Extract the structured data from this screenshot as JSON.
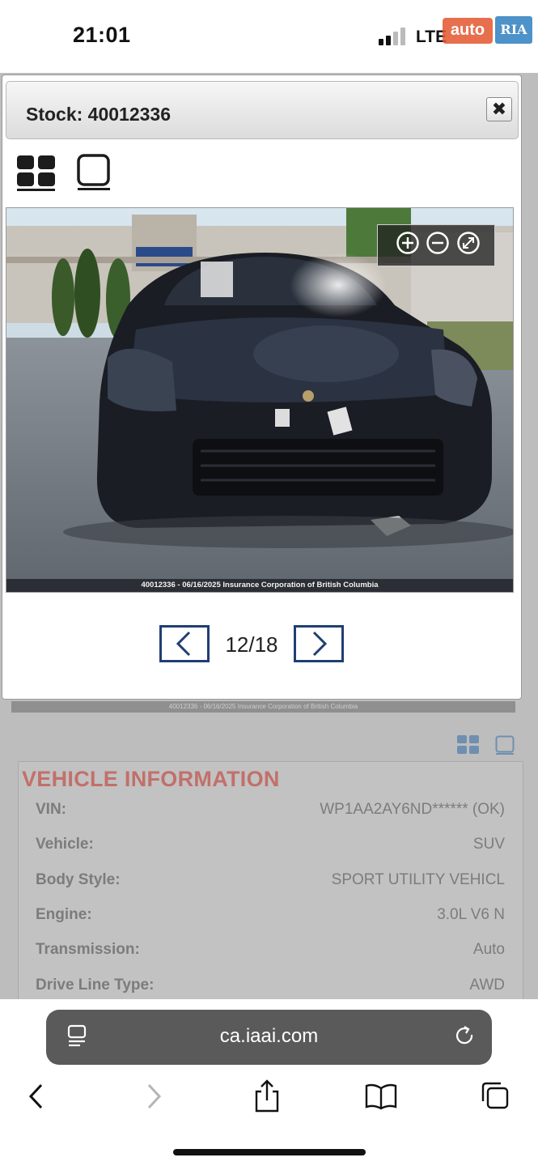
{
  "status_bar": {
    "time": "21:01",
    "network": "LTE"
  },
  "watermark": {
    "left": "auto",
    "right": "RIA"
  },
  "modal": {
    "title": "Stock: 40012336",
    "close_label": "✖",
    "photo_caption": "40012336 - 06/16/2025 Insurance Corporation of British Columbia",
    "pager": {
      "current": 12,
      "total": 18,
      "text": "12/18"
    }
  },
  "background_page": {
    "strip_caption": "40012336 - 06/16/2025 Insurance Corporation of British Columbia",
    "vehicle_info": {
      "title": "VEHICLE INFORMATION",
      "rows": [
        {
          "label": "VIN:",
          "value": "WP1AA2AY6ND****** (OK)"
        },
        {
          "label": "Vehicle:",
          "value": "SUV"
        },
        {
          "label": "Body Style:",
          "value": "SPORT UTILITY VEHICL"
        },
        {
          "label": "Engine:",
          "value": "3.0L V6 N"
        },
        {
          "label": "Transmission:",
          "value": "Auto"
        },
        {
          "label": "Drive Line Type:",
          "value": "AWD"
        }
      ]
    }
  },
  "browser": {
    "url": "ca.iaai.com"
  },
  "colors": {
    "pager_border": "#1f3f73",
    "info_title": "#c2706a",
    "url_bar": "#5a5a5a"
  }
}
